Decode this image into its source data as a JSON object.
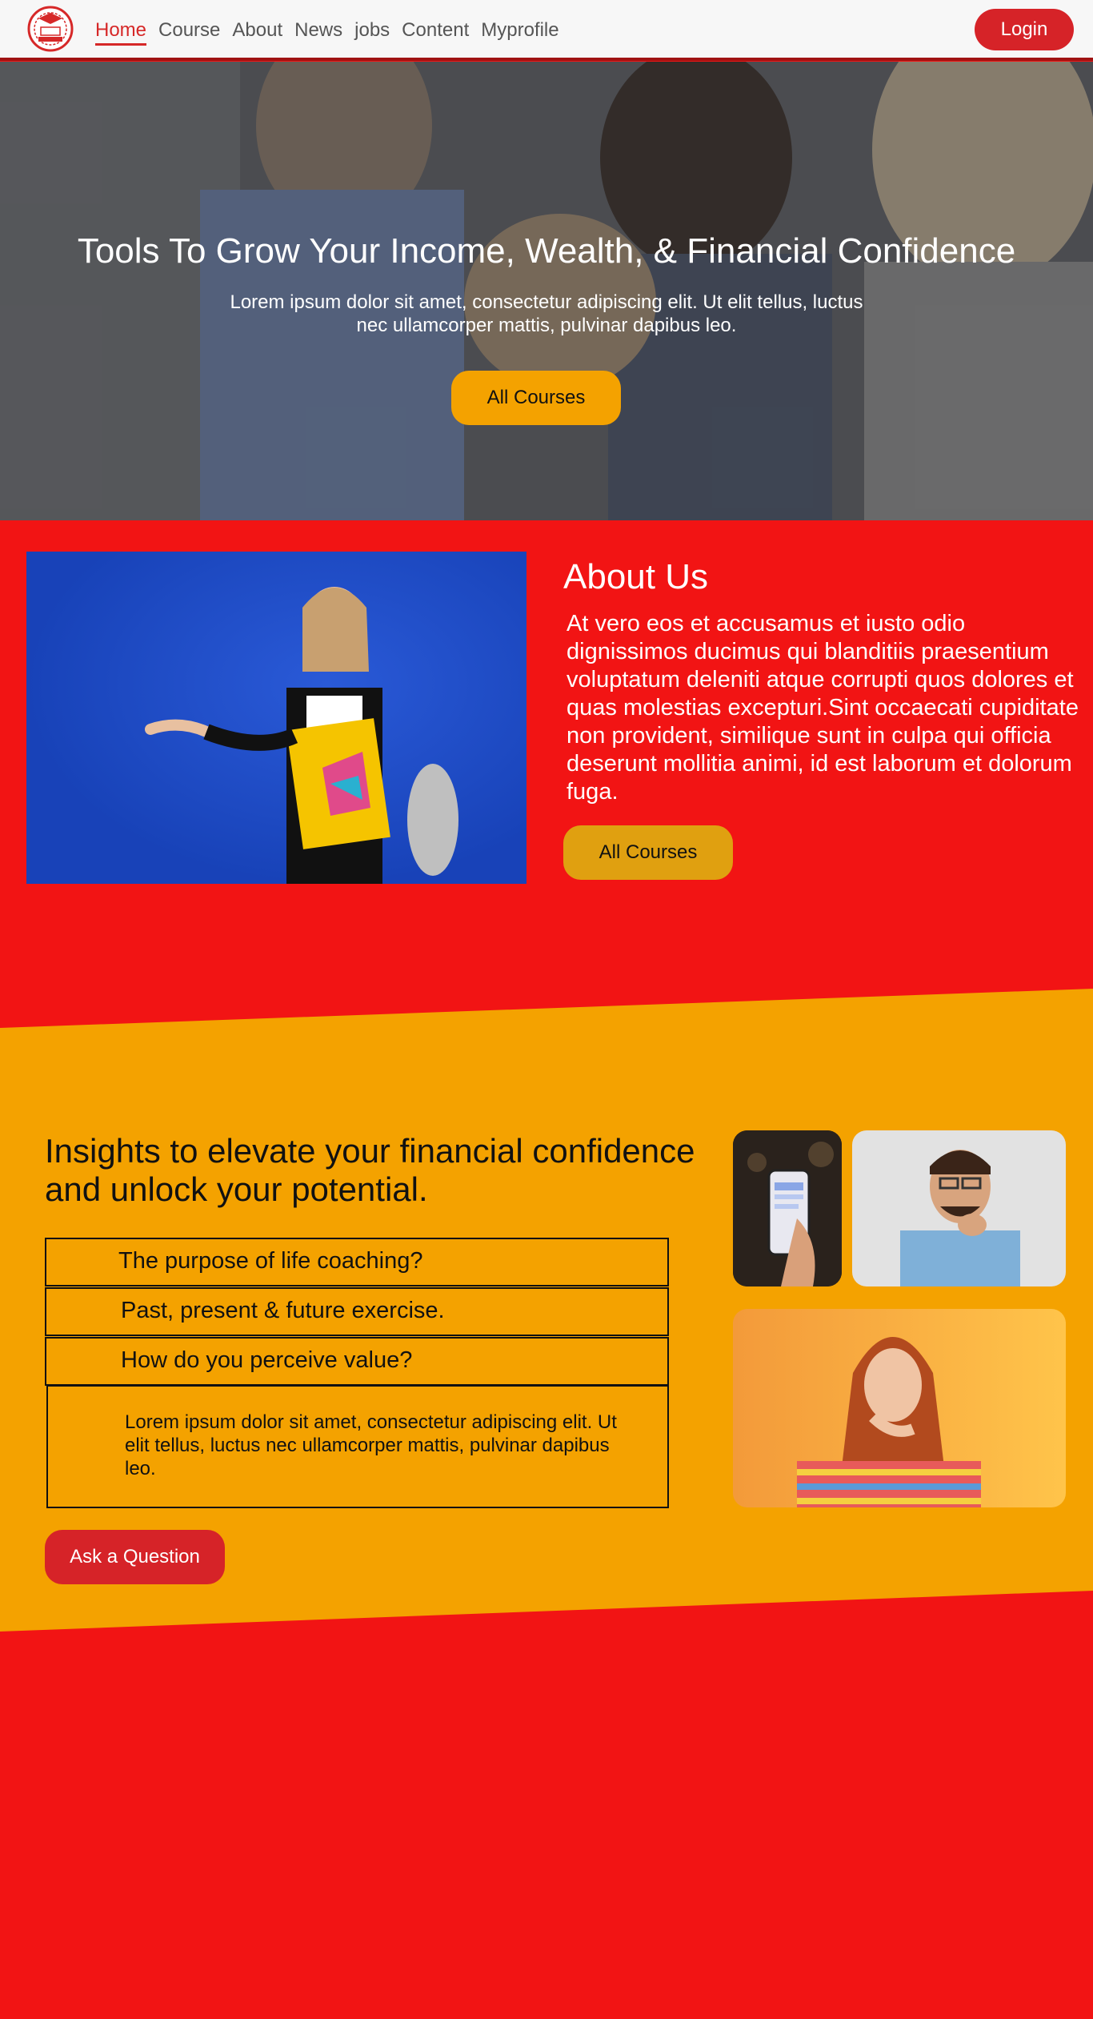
{
  "nav": {
    "links": [
      "Home",
      "Course",
      "About",
      "News",
      "jobs",
      "Content",
      "Myprofile"
    ],
    "login_label": "Login"
  },
  "hero": {
    "title": "Tools To Grow Your Income, Wealth, &  Financial Confidence",
    "subtitle": "Lorem ipsum dolor sit amet, consectetur adipiscing elit. Ut elit tellus, luctus nec ullamcorper mattis, pulvinar dapibus leo.",
    "button_label": "All Courses"
  },
  "about": {
    "title": "About Us",
    "text": "At vero eos et accusamus et iusto odio dignissimos ducimus qui blanditiis praesentium voluptatum deleniti atque corrupti quos dolores et quas molestias excepturi.Sint occaecati cupiditate non provident, similique sunt in culpa qui officia deserunt mollitia animi, id est laborum et dolorum fuga.",
    "button_label": "All Courses"
  },
  "insights": {
    "title": "Insights to elevate your financial confidence and unlock your potential.",
    "accordion": [
      "The purpose of life coaching?",
      "Past, present & future exercise.",
      "How do you perceive value?"
    ],
    "answer": "Lorem ipsum dolor sit amet, consectetur adipiscing elit. Ut elit tellus, luctus nec ullamcorper mattis, pulvinar dapibus leo.",
    "ask_label": "Ask a Question"
  },
  "colors": {
    "brand_red": "#f21414",
    "button_red": "#d62328",
    "orange": "#f4a200"
  }
}
